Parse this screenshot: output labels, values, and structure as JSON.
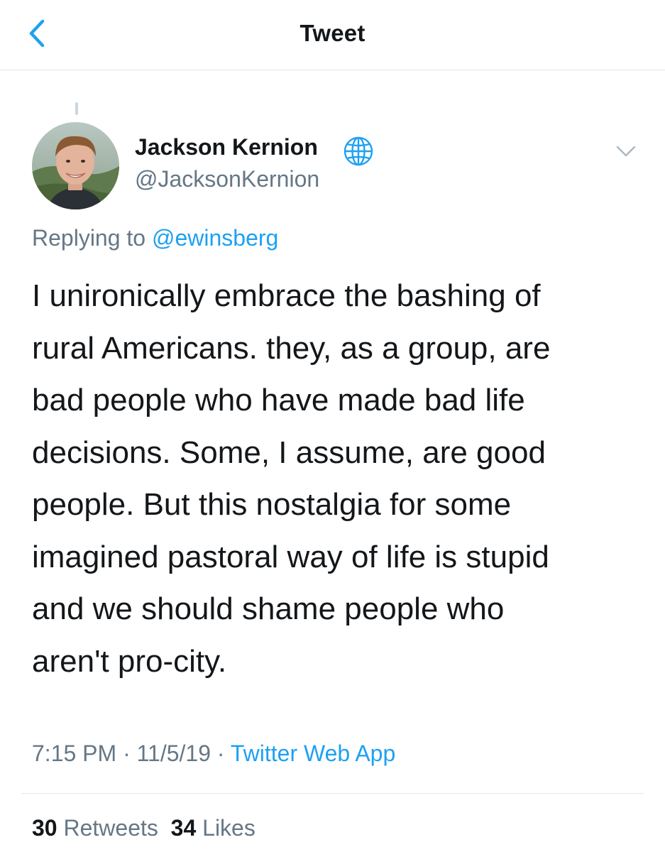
{
  "header": {
    "title": "Tweet",
    "back_icon": "chevron-left-icon"
  },
  "tweet": {
    "author": {
      "display_name": "Jackson Kernion",
      "handle": "@JacksonKernion",
      "badge_icon": "globe-icon",
      "avatar": "profile-photo"
    },
    "replying_prefix": "Replying to",
    "replying_to": "@ewinsberg",
    "text_lines": [
      "I unironically embrace the bashing of",
      "rural Americans. they, as a group, are",
      "bad people who have made bad life",
      "decisions. Some, I assume, are good",
      "people. But this nostalgia for some",
      "imagined pastoral way of life is stupid",
      "and we should shame people who",
      "aren't pro-city."
    ],
    "time": "7:15 PM",
    "date": "11/5/19",
    "separator": "·",
    "source": "Twitter Web App",
    "stats": {
      "retweets_count": "30",
      "retweets_label": "Retweets",
      "likes_count": "34",
      "likes_label": "Likes"
    }
  },
  "colors": {
    "accent": "#1da1f2",
    "text": "#14171a",
    "secondary": "#657786",
    "divider": "#e1e8ed"
  }
}
